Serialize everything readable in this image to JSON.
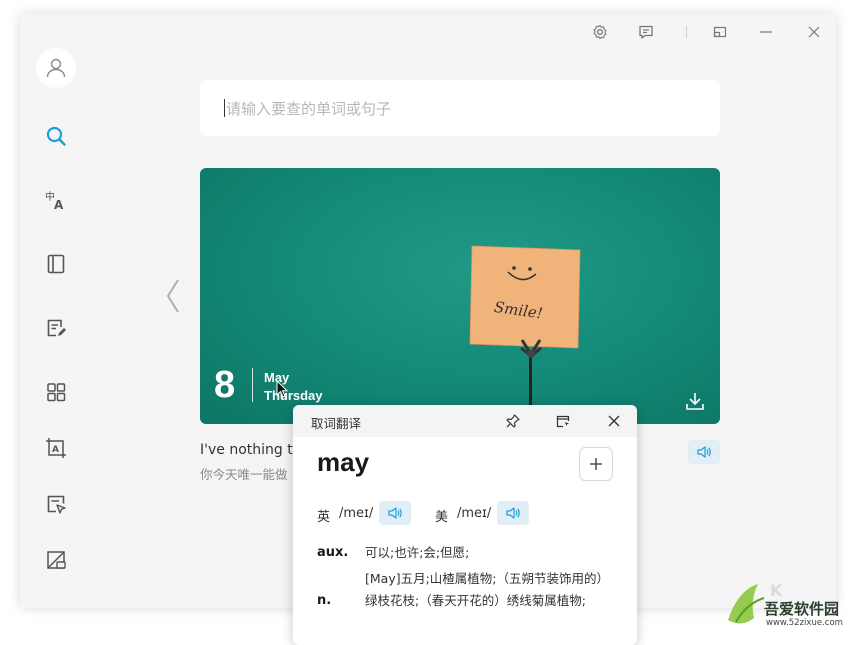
{
  "titlebar": {
    "icons": [
      "gear-icon",
      "feedback-icon",
      "mini-window-icon",
      "minimize-icon",
      "close-icon"
    ]
  },
  "sidebar": {
    "items": [
      {
        "name": "search",
        "icon": "search-icon",
        "active": true
      },
      {
        "name": "translate",
        "icon": "translate-icon"
      },
      {
        "name": "wordbook",
        "icon": "book-icon"
      },
      {
        "name": "write",
        "icon": "write-icon"
      },
      {
        "name": "apps",
        "icon": "grid-icon"
      },
      {
        "name": "ocr",
        "icon": "ocr-icon"
      },
      {
        "name": "select-translate",
        "icon": "select-translate-icon"
      },
      {
        "name": "screenshot",
        "icon": "screenshot-icon"
      }
    ]
  },
  "search": {
    "placeholder": "请输入要查的单词或句子"
  },
  "daily_card": {
    "day": "8",
    "month": "May",
    "weekday": "Thursday",
    "note_text": "Smile!",
    "quote_en": "I've nothing to",
    "quote_zh": "你今天唯一能做"
  },
  "popup": {
    "title": "取词翻译",
    "word": "may",
    "uk_label": "英",
    "uk_ipa": "/meɪ/",
    "us_label": "美",
    "us_ipa": "/meɪ/",
    "definitions": [
      {
        "pos": "aux.",
        "text": "可以;也许;会;但愿;"
      },
      {
        "pos": "n.",
        "text": "[May]五月;山楂属植物;（五朔节装饰用的）绿枝花枝;（春天开花的）绣线菊属植物;"
      }
    ]
  },
  "watermark": {
    "text": "吾爱软件园",
    "url": "www.52zixue.com"
  },
  "colors": {
    "accent": "#1a9fd6",
    "card_bg": "#148a78",
    "window_bg": "#f5f5f5"
  }
}
